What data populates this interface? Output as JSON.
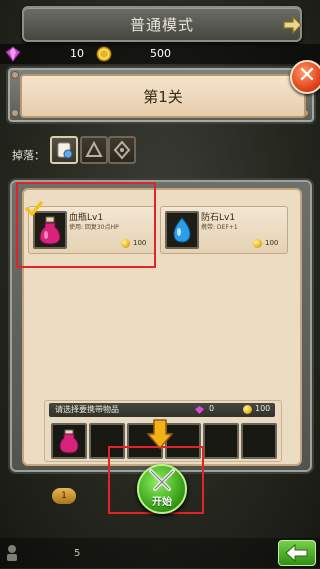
{
  "header": {
    "mode_title": "普通模式"
  },
  "currency": {
    "gems": "10",
    "gold": "500"
  },
  "level": {
    "title": "第1关"
  },
  "drops": {
    "label": "掉落："
  },
  "items": [
    {
      "name": "血瓶Lv1",
      "desc": "使用: 回复30点HP",
      "price": "100",
      "checked": true,
      "icon": "red-potion-icon"
    },
    {
      "name": "防石Lv1",
      "desc": "携带: DEF+1",
      "price": "100",
      "checked": false,
      "icon": "blue-gem-icon"
    }
  ],
  "tray": {
    "prompt": "请选择要携带物品",
    "gem_cost": "0",
    "gold_cost": "100"
  },
  "start_button": {
    "label": "开始"
  },
  "page_indicator": {
    "value": "1"
  },
  "bottom": {
    "count": "5"
  },
  "colors": {
    "accent_green": "#3ca51a",
    "close_red": "#e2461c",
    "highlight_red": "#e0242a",
    "panel_beige": "#ecdcc2"
  }
}
